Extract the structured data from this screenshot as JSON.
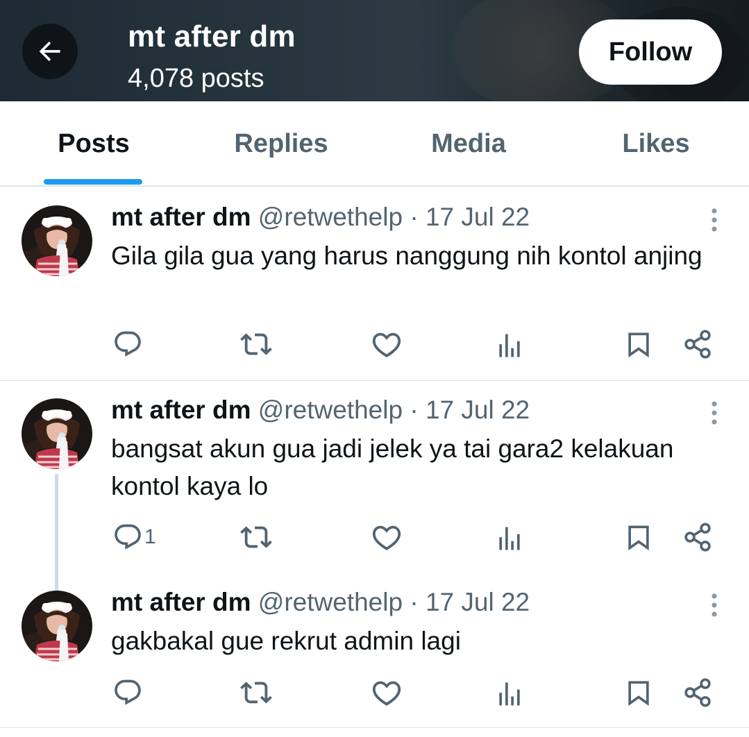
{
  "header": {
    "title": "mt after dm",
    "posts_count": "4,078 posts",
    "follow_label": "Follow"
  },
  "tabs": [
    {
      "label": "Posts",
      "active": true
    },
    {
      "label": "Replies",
      "active": false
    },
    {
      "label": "Media",
      "active": false
    },
    {
      "label": "Likes",
      "active": false
    }
  ],
  "tweets": [
    {
      "name": "mt after dm",
      "handle": "@retwethelp",
      "separator": "·",
      "date": "17 Jul 22",
      "text": "Gila gila gua yang harus nanggung nih kontol anjing",
      "reply_count": ""
    },
    {
      "name": "mt after dm",
      "handle": "@retwethelp",
      "separator": "·",
      "date": "17 Jul 22",
      "text": "bangsat akun gua jadi jelek ya tai gara2 kelakuan kontol kaya lo",
      "reply_count": "1"
    },
    {
      "name": "mt after dm",
      "handle": "@retwethelp",
      "separator": "·",
      "date": "17 Jul 22",
      "text": "gakbakal gue rekrut admin lagi",
      "reply_count": ""
    }
  ],
  "colors": {
    "accent": "#1d9bf0",
    "text_primary": "#0f1419",
    "text_secondary": "#536471",
    "divider": "#dfe3e6"
  },
  "icons": [
    "back-arrow-icon",
    "more-options-icon",
    "reply-icon",
    "repost-icon",
    "like-icon",
    "views-icon",
    "bookmark-icon",
    "share-icon"
  ]
}
